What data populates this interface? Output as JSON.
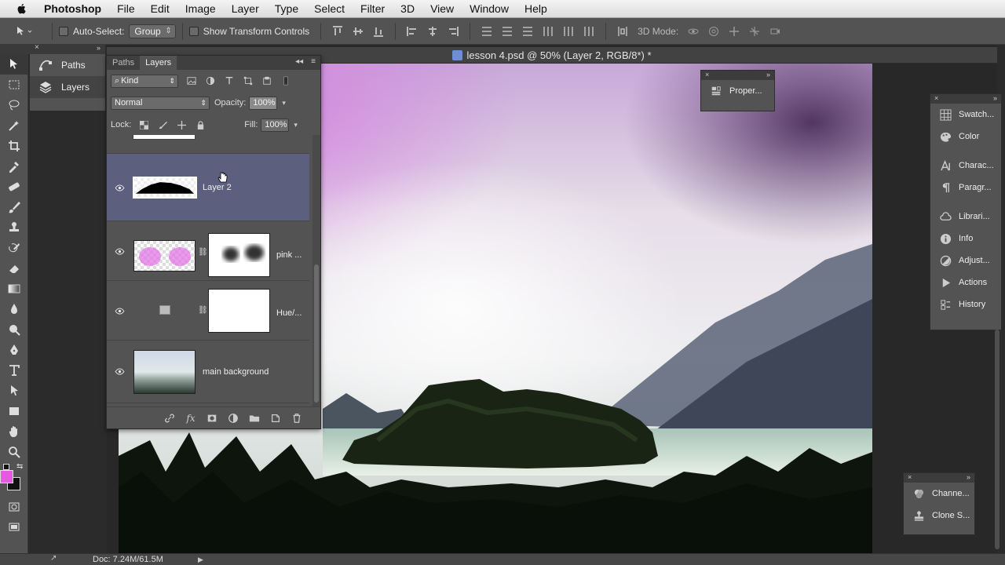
{
  "menubar": {
    "app": "Photoshop",
    "items": [
      "File",
      "Edit",
      "Image",
      "Layer",
      "Type",
      "Select",
      "Filter",
      "3D",
      "View",
      "Window",
      "Help"
    ]
  },
  "options_bar": {
    "auto_select_label": "Auto-Select:",
    "auto_select_value": "Group",
    "transform_controls_label": "Show Transform Controls",
    "mode_3d_label": "3D Mode:"
  },
  "left_dock": {
    "items": [
      {
        "label": "Paths",
        "icon": "paths-icon"
      },
      {
        "label": "Layers",
        "icon": "layers-icon"
      }
    ]
  },
  "document": {
    "tab_title": "lesson 4.psd @ 50% (Layer 2, RGB/8*) *"
  },
  "layers_panel": {
    "tabs": [
      "Paths",
      "Layers"
    ],
    "active_tab": "Layers",
    "filter_kind": "Kind",
    "blend_mode": "Normal",
    "opacity_label": "Opacity:",
    "opacity_value": "100%",
    "lock_label": "Lock:",
    "fill_label": "Fill:",
    "fill_value": "100%",
    "layers": [
      {
        "name": "Layer 2",
        "selected": true
      },
      {
        "name": "pink ...",
        "selected": false
      },
      {
        "name": "Hue/...",
        "selected": false
      },
      {
        "name": "main background",
        "selected": false
      }
    ]
  },
  "properties_float": {
    "label": "Proper..."
  },
  "right_dock": {
    "items": [
      {
        "label": "Swatch...",
        "icon": "swatches-icon"
      },
      {
        "label": "Color",
        "icon": "color-icon"
      },
      {
        "label": "Charac...",
        "icon": "character-icon"
      },
      {
        "label": "Paragr...",
        "icon": "paragraph-icon"
      },
      {
        "label": "Librari...",
        "icon": "libraries-icon"
      },
      {
        "label": "Info",
        "icon": "info-icon"
      },
      {
        "label": "Adjust...",
        "icon": "adjustments-icon"
      },
      {
        "label": "Actions",
        "icon": "actions-icon"
      },
      {
        "label": "History",
        "icon": "history-icon"
      }
    ]
  },
  "right_bottom_dock": {
    "items": [
      {
        "label": "Channe...",
        "icon": "channels-icon"
      },
      {
        "label": "Clone S...",
        "icon": "clone-source-icon"
      }
    ]
  },
  "status_bar": {
    "doc_info": "Doc: 7.24M/61.5M"
  },
  "colors": {
    "foreground": "#e45ae0",
    "background": "#111111",
    "selected_layer": "#5c5f7d",
    "panel": "#535353"
  }
}
